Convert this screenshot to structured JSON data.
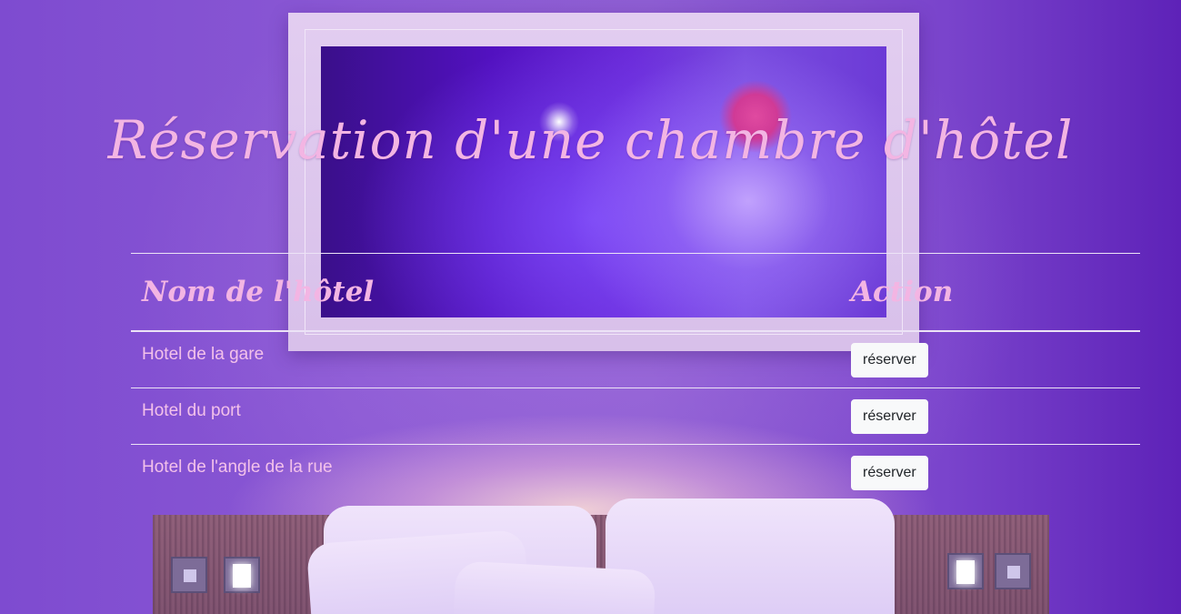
{
  "page": {
    "title": "Réservation d'une chambre d'hôtel"
  },
  "table": {
    "headers": {
      "name": "Nom de l'hôtel",
      "action": "Action"
    },
    "rows": [
      {
        "name": "Hotel de la gare",
        "action_label": "réserver"
      },
      {
        "name": "Hotel du port",
        "action_label": "réserver"
      },
      {
        "name": "Hotel de l'angle de la rue",
        "action_label": "réserver"
      }
    ]
  },
  "theme": {
    "heading_color": "#f3b5e3",
    "text_color": "#f3c1ea",
    "button_bg": "#f8f9fa",
    "button_text": "#212529",
    "background_tint": "#7b45c9"
  }
}
